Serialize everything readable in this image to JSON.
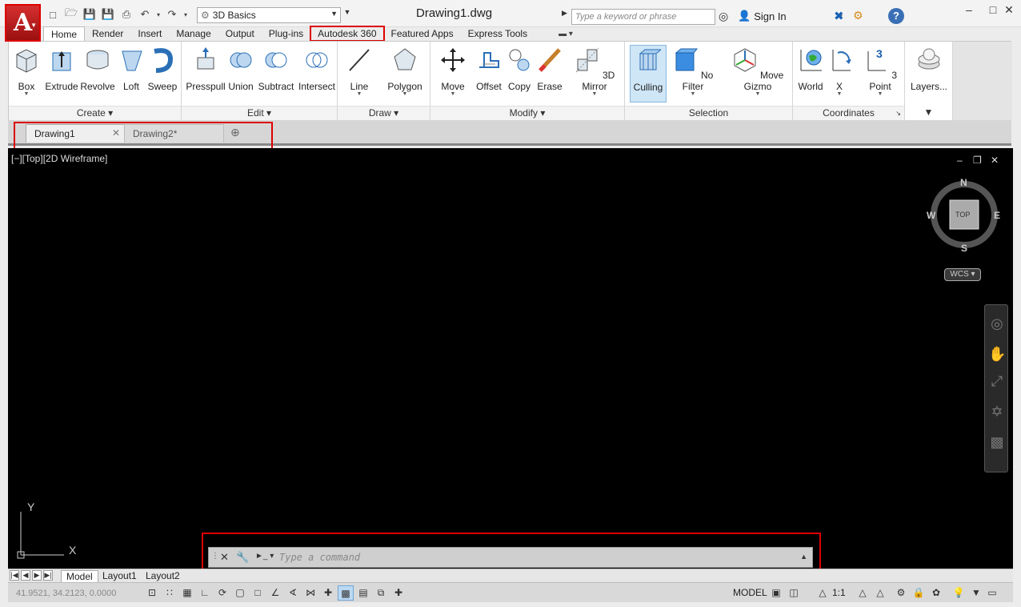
{
  "app_button": {
    "letter": "A"
  },
  "workspace": {
    "value": "3D Basics"
  },
  "title": "Drawing1.dwg",
  "search": {
    "placeholder": "Type a keyword or phrase"
  },
  "signin": {
    "label": "Sign In"
  },
  "help": {
    "label": "?"
  },
  "ribbon_tabs": [
    "Home",
    "Render",
    "Insert",
    "Manage",
    "Output",
    "Plug-ins",
    "Autodesk 360",
    "Featured Apps",
    "Express Tools"
  ],
  "panels": {
    "create": {
      "title": "Create ▾",
      "tools": [
        "Box",
        "Extrude",
        "Revolve",
        "Loft",
        "Sweep"
      ]
    },
    "edit": {
      "title": "Edit ▾",
      "tools": [
        "Presspull",
        "Union",
        "Subtract",
        "Intersect"
      ]
    },
    "draw": {
      "title": "Draw ▾",
      "tools": [
        "Line",
        "Polygon"
      ]
    },
    "modify": {
      "title": "Modify ▾",
      "tools": [
        "Move",
        "Offset",
        "Copy",
        "Erase",
        "3D Mirror"
      ]
    },
    "selection": {
      "title": "Selection",
      "tools": [
        "Culling",
        "No Filter",
        "Move Gizmo"
      ]
    },
    "coordinates": {
      "title": "Coordinates",
      "tools": [
        "World",
        "X",
        "3 Point"
      ]
    },
    "layers": {
      "tools": [
        "Layers..."
      ]
    }
  },
  "doc_tabs": [
    "Drawing1",
    "Drawing2*"
  ],
  "viewport": {
    "label": "[−][Top][2D Wireframe]",
    "compass": {
      "n": "N",
      "s": "S",
      "e": "E",
      "w": "W",
      "cube": "TOP"
    },
    "wcs": "WCS",
    "ucs": {
      "x": "X",
      "y": "Y"
    }
  },
  "command": {
    "placeholder": "Type a command"
  },
  "layout_tabs": [
    "Model",
    "Layout1",
    "Layout2"
  ],
  "status": {
    "coords": "41.9521, 34.2123, 0.0000",
    "model": "MODEL",
    "scale": "1:1"
  },
  "colors": {
    "accent": "#d62f2f",
    "highlight": "#dd0000",
    "viewport_bg": "#000000"
  }
}
